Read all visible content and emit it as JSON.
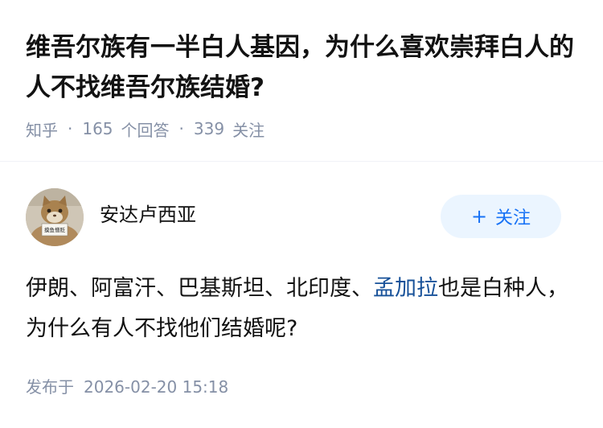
{
  "question": {
    "title": "维吾尔族有一半白人基因，为什么喜欢崇拜白人的人不找维吾尔族结婚?",
    "source": "知乎",
    "separator": "·",
    "answer_count": "165",
    "answer_label": "个回答",
    "follower_count": "339",
    "follower_label": "关注"
  },
  "answer": {
    "author_name": "安达卢西亚",
    "avatar_sign_text": "摸鱼憎贬",
    "follow_button_plus": "+",
    "follow_button_label": "关注",
    "content_before_link": "伊朗、阿富汗、巴基斯坦、北印度、",
    "content_link": "孟加拉",
    "content_after_link": "也是白种人，为什么有人不找他们结婚呢?",
    "published_label": "发布于",
    "published_time": "2026-02-20 15:18"
  },
  "colors": {
    "title": "#121212",
    "meta": "#8590a6",
    "link": "#175199",
    "follow_bg": "#ebf5ff",
    "follow_text": "#1772f6"
  }
}
